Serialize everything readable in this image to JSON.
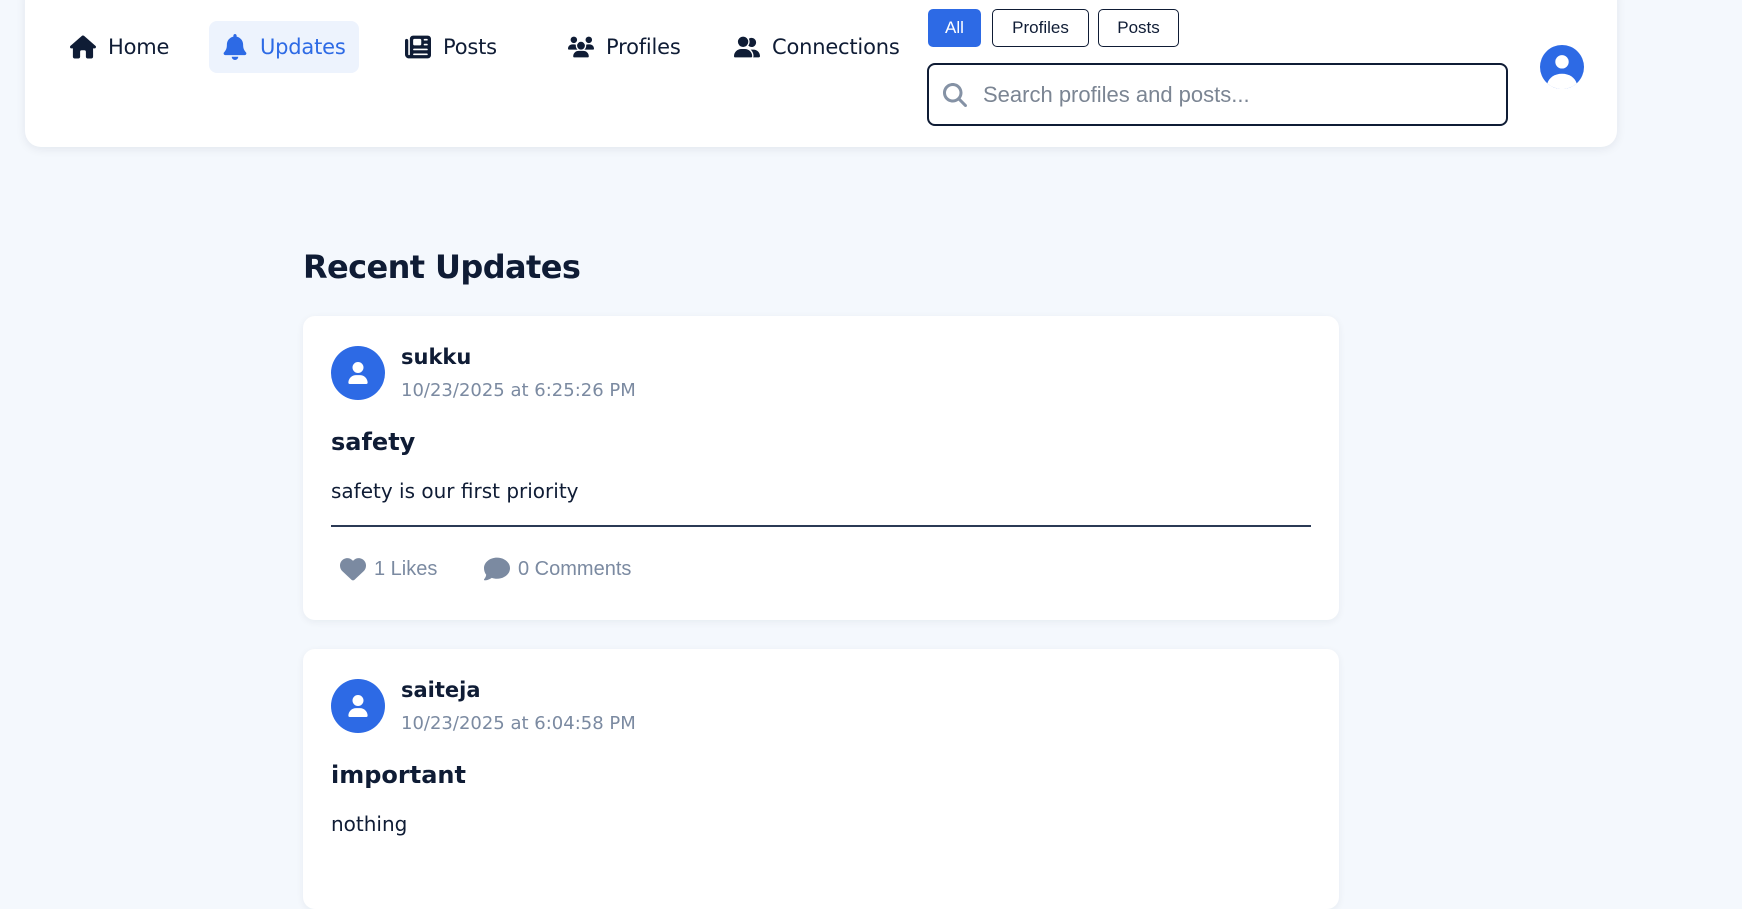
{
  "nav": {
    "items": [
      {
        "label": "Home",
        "icon": "home-icon"
      },
      {
        "label": "Updates",
        "icon": "bell-icon",
        "active": true
      },
      {
        "label": "Posts",
        "icon": "newspaper-icon"
      },
      {
        "label": "Profiles",
        "icon": "users-icon"
      },
      {
        "label": "Connections",
        "icon": "user-friends-icon"
      }
    ]
  },
  "filters": {
    "options": [
      "All",
      "Profiles",
      "Posts"
    ],
    "selected": "All"
  },
  "search": {
    "placeholder": "Search profiles and posts...",
    "value": ""
  },
  "page": {
    "heading": "Recent Updates"
  },
  "posts": [
    {
      "author": "sukku",
      "timestamp": "10/23/2025 at 6:25:26 PM",
      "title": "safety",
      "content": "safety is our first priority",
      "likes_label": "1 Likes",
      "comments_label": "0 Comments"
    },
    {
      "author": "saiteja",
      "timestamp": "10/23/2025 at 6:04:58 PM",
      "title": "important",
      "content": "nothing"
    }
  ],
  "colors": {
    "accent": "#2d6ae5",
    "text": "#0f1c35",
    "muted": "#7b8aa1",
    "background": "#f4f8fd",
    "active_nav_bg": "#edf3fd"
  }
}
